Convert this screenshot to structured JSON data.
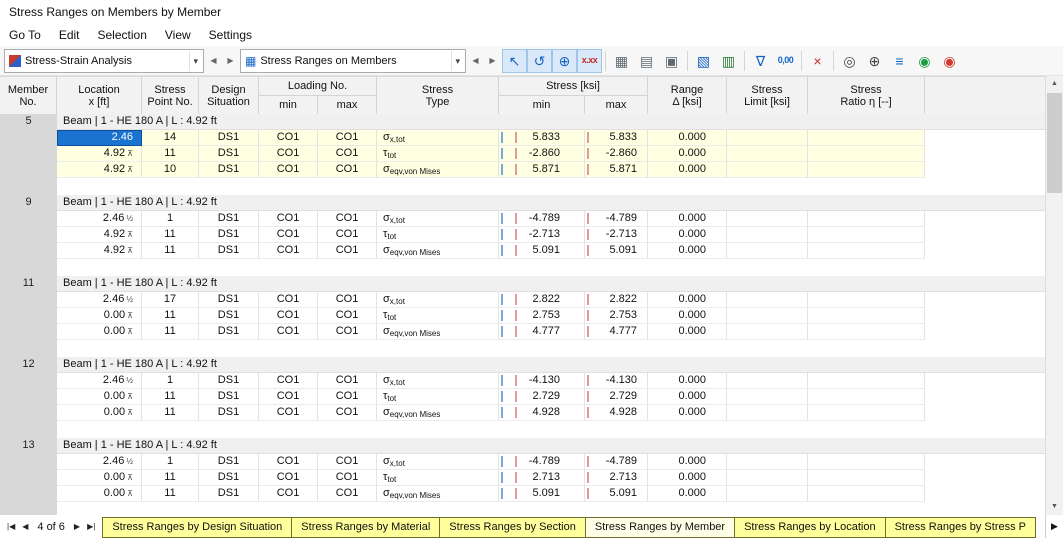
{
  "window": {
    "title": "Stress Ranges on Members by Member"
  },
  "menu": {
    "items": [
      "Go To",
      "Edit",
      "Selection",
      "View",
      "Settings"
    ]
  },
  "toolbar": {
    "analysis_dropdown": {
      "value": "Stress-Strain Analysis"
    },
    "table_dropdown": {
      "value": "Stress Ranges on Members"
    },
    "icons": [
      {
        "name": "select-pointer-icon",
        "glyph": "↖",
        "color": "#1663c7",
        "bg": true
      },
      {
        "name": "lasso-select-icon",
        "glyph": "↺",
        "color": "#1663c7",
        "bg": true
      },
      {
        "name": "zoom-cursor-icon",
        "glyph": "⊕",
        "color": "#1663c7",
        "bg": true
      },
      {
        "name": "result-values-icon",
        "glyph": "x.xx",
        "color": "#c62828",
        "bg": true,
        "text": true
      },
      {
        "name": "sep"
      },
      {
        "name": "table-grid-icon",
        "glyph": "▦",
        "color": "#5f6a72"
      },
      {
        "name": "print-preview-icon",
        "glyph": "▤",
        "color": "#5f6a72"
      },
      {
        "name": "printer-icon",
        "glyph": "▣",
        "color": "#5f6a72"
      },
      {
        "name": "sep"
      },
      {
        "name": "excel-export-icon",
        "glyph": "▧",
        "color": "#1663c7"
      },
      {
        "name": "export-table-icon",
        "glyph": "▥",
        "color": "#2e7d32"
      },
      {
        "name": "sep"
      },
      {
        "name": "filter-icon",
        "glyph": "∇",
        "color": "#1663c7"
      },
      {
        "name": "decimal-places-icon",
        "glyph": "0,00",
        "color": "#1663c7",
        "text": true
      },
      {
        "name": "sep"
      },
      {
        "name": "delete-results-icon",
        "glyph": "×",
        "color": "#c62828"
      },
      {
        "name": "sep"
      },
      {
        "name": "search-icon",
        "glyph": "◎",
        "color": "#444444"
      },
      {
        "name": "zoom-table-icon",
        "glyph": "⊕",
        "color": "#444444"
      },
      {
        "name": "result-diagram-icon",
        "glyph": "≡",
        "color": "#1663c7"
      },
      {
        "name": "color-settings-icon",
        "glyph": "◉",
        "color": "#1a9e3f"
      },
      {
        "name": "color-scale-icon",
        "glyph": "◉",
        "color": "#d03a2e"
      }
    ]
  },
  "colors": {
    "selection": "#1a73d1",
    "row_highlight": "#ffffe1",
    "tab_inactive": "#ffff9b",
    "tab_active": "#ffffe8",
    "indicator_blue": "#7da7d9",
    "indicator_red": "#e09a9a"
  },
  "table": {
    "columns": [
      {
        "id": "member_no",
        "label1": "Member",
        "label2": "No."
      },
      {
        "id": "location",
        "label1": "Location",
        "label2": "x [ft]"
      },
      {
        "id": "stress_point",
        "label1": "Stress",
        "label2": "Point No."
      },
      {
        "id": "design_situation",
        "label1": "Design",
        "label2": "Situation"
      },
      {
        "id": "loading_no",
        "label1": "Loading No.",
        "subs": [
          "min",
          "max"
        ]
      },
      {
        "id": "stress_type",
        "label1": "Stress",
        "label2": "Type"
      },
      {
        "id": "stress_ksi",
        "label1": "Stress [ksi]",
        "subs": [
          "min",
          "max"
        ]
      },
      {
        "id": "range",
        "label1": "Range",
        "label2": "Δ [ksi]"
      },
      {
        "id": "stress_limit",
        "label1": "Stress",
        "label2": "Limit [ksi]"
      },
      {
        "id": "stress_ratio",
        "label1": "Stress",
        "label2": "Ratio η [--]"
      }
    ],
    "groups": [
      {
        "member_no": "5",
        "title": "Beam | 1 - HE 180 A | L : 4.92 ft",
        "highlighted": true,
        "rows": [
          {
            "location": "2.46",
            "location_mark": "",
            "selected": true,
            "stress_point": "14",
            "design_situation": "DS1",
            "loading_min": "CO1",
            "loading_max": "CO1",
            "stress_symbol": "σ",
            "stress_subscript": "x,tot",
            "stress_min": "5.833",
            "stress_max": "5.833",
            "range": "0.000",
            "stress_limit": "",
            "stress_ratio": ""
          },
          {
            "location": "4.92",
            "location_mark": "⊼",
            "stress_point": "11",
            "design_situation": "DS1",
            "loading_min": "CO1",
            "loading_max": "CO1",
            "stress_symbol": "τ",
            "stress_subscript": "tot",
            "stress_min": "-2.860",
            "stress_max": "-2.860",
            "range": "0.000",
            "stress_limit": "",
            "stress_ratio": ""
          },
          {
            "location": "4.92",
            "location_mark": "⊼",
            "stress_point": "10",
            "design_situation": "DS1",
            "loading_min": "CO1",
            "loading_max": "CO1",
            "stress_symbol": "σ",
            "stress_subscript": "eqv,von Mises",
            "stress_min": "5.871",
            "stress_max": "5.871",
            "range": "0.000",
            "stress_limit": "",
            "stress_ratio": ""
          }
        ]
      },
      {
        "member_no": "9",
        "title": "Beam | 1 - HE 180 A | L : 4.92 ft",
        "highlighted": false,
        "rows": [
          {
            "location": "2.46",
            "location_mark": "½",
            "stress_point": "1",
            "design_situation": "DS1",
            "loading_min": "CO1",
            "loading_max": "CO1",
            "stress_symbol": "σ",
            "stress_subscript": "x,tot",
            "stress_min": "-4.789",
            "stress_max": "-4.789",
            "range": "0.000",
            "stress_limit": "",
            "stress_ratio": ""
          },
          {
            "location": "4.92",
            "location_mark": "⊼",
            "stress_point": "11",
            "design_situation": "DS1",
            "loading_min": "CO1",
            "loading_max": "CO1",
            "stress_symbol": "τ",
            "stress_subscript": "tot",
            "stress_min": "-2.713",
            "stress_max": "-2.713",
            "range": "0.000",
            "stress_limit": "",
            "stress_ratio": ""
          },
          {
            "location": "4.92",
            "location_mark": "⊼",
            "stress_point": "11",
            "design_situation": "DS1",
            "loading_min": "CO1",
            "loading_max": "CO1",
            "stress_symbol": "σ",
            "stress_subscript": "eqv,von Mises",
            "stress_min": "5.091",
            "stress_max": "5.091",
            "range": "0.000",
            "stress_limit": "",
            "stress_ratio": ""
          }
        ]
      },
      {
        "member_no": "11",
        "title": "Beam | 1 - HE 180 A | L : 4.92 ft",
        "highlighted": false,
        "rows": [
          {
            "location": "2.46",
            "location_mark": "½",
            "stress_point": "17",
            "design_situation": "DS1",
            "loading_min": "CO1",
            "loading_max": "CO1",
            "stress_symbol": "σ",
            "stress_subscript": "x,tot",
            "stress_min": "2.822",
            "stress_max": "2.822",
            "range": "0.000",
            "stress_limit": "",
            "stress_ratio": ""
          },
          {
            "location": "0.00",
            "location_mark": "⊼",
            "stress_point": "11",
            "design_situation": "DS1",
            "loading_min": "CO1",
            "loading_max": "CO1",
            "stress_symbol": "τ",
            "stress_subscript": "tot",
            "stress_min": "2.753",
            "stress_max": "2.753",
            "range": "0.000",
            "stress_limit": "",
            "stress_ratio": ""
          },
          {
            "location": "0.00",
            "location_mark": "⊼",
            "stress_point": "11",
            "design_situation": "DS1",
            "loading_min": "CO1",
            "loading_max": "CO1",
            "stress_symbol": "σ",
            "stress_subscript": "eqv,von Mises",
            "stress_min": "4.777",
            "stress_max": "4.777",
            "range": "0.000",
            "stress_limit": "",
            "stress_ratio": ""
          }
        ]
      },
      {
        "member_no": "12",
        "title": "Beam | 1 - HE 180 A | L : 4.92 ft",
        "highlighted": false,
        "rows": [
          {
            "location": "2.46",
            "location_mark": "½",
            "stress_point": "1",
            "design_situation": "DS1",
            "loading_min": "CO1",
            "loading_max": "CO1",
            "stress_symbol": "σ",
            "stress_subscript": "x,tot",
            "stress_min": "-4.130",
            "stress_max": "-4.130",
            "range": "0.000",
            "stress_limit": "",
            "stress_ratio": ""
          },
          {
            "location": "0.00",
            "location_mark": "⊼",
            "stress_point": "11",
            "design_situation": "DS1",
            "loading_min": "CO1",
            "loading_max": "CO1",
            "stress_symbol": "τ",
            "stress_subscript": "tot",
            "stress_min": "2.729",
            "stress_max": "2.729",
            "range": "0.000",
            "stress_limit": "",
            "stress_ratio": ""
          },
          {
            "location": "0.00",
            "location_mark": "⊼",
            "stress_point": "11",
            "design_situation": "DS1",
            "loading_min": "CO1",
            "loading_max": "CO1",
            "stress_symbol": "σ",
            "stress_subscript": "eqv,von Mises",
            "stress_min": "4.928",
            "stress_max": "4.928",
            "range": "0.000",
            "stress_limit": "",
            "stress_ratio": ""
          }
        ]
      },
      {
        "member_no": "13",
        "title": "Beam | 1 - HE 180 A | L : 4.92 ft",
        "highlighted": false,
        "rows": [
          {
            "location": "2.46",
            "location_mark": "½",
            "stress_point": "1",
            "design_situation": "DS1",
            "loading_min": "CO1",
            "loading_max": "CO1",
            "stress_symbol": "σ",
            "stress_subscript": "x,tot",
            "stress_min": "-4.789",
            "stress_max": "-4.789",
            "range": "0.000",
            "stress_limit": "",
            "stress_ratio": ""
          },
          {
            "location": "0.00",
            "location_mark": "⊼",
            "stress_point": "11",
            "design_situation": "DS1",
            "loading_min": "CO1",
            "loading_max": "CO1",
            "stress_symbol": "τ",
            "stress_subscript": "tot",
            "stress_min": "2.713",
            "stress_max": "2.713",
            "range": "0.000",
            "stress_limit": "",
            "stress_ratio": ""
          },
          {
            "location": "0.00",
            "location_mark": "⊼",
            "stress_point": "11",
            "design_situation": "DS1",
            "loading_min": "CO1",
            "loading_max": "CO1",
            "stress_symbol": "σ",
            "stress_subscript": "eqv,von Mises",
            "stress_min": "5.091",
            "stress_max": "5.091",
            "range": "0.000",
            "stress_limit": "",
            "stress_ratio": ""
          }
        ]
      }
    ]
  },
  "footer": {
    "pager": {
      "label": "4 of 6"
    },
    "tabs": [
      {
        "label": "Stress Ranges by Design Situation",
        "active": false
      },
      {
        "label": "Stress Ranges by Material",
        "active": false
      },
      {
        "label": "Stress Ranges by Section",
        "active": false
      },
      {
        "label": "Stress Ranges by Member",
        "active": true
      },
      {
        "label": "Stress Ranges by Location",
        "active": false
      },
      {
        "label": "Stress Ranges by Stress P",
        "active": false
      }
    ]
  }
}
